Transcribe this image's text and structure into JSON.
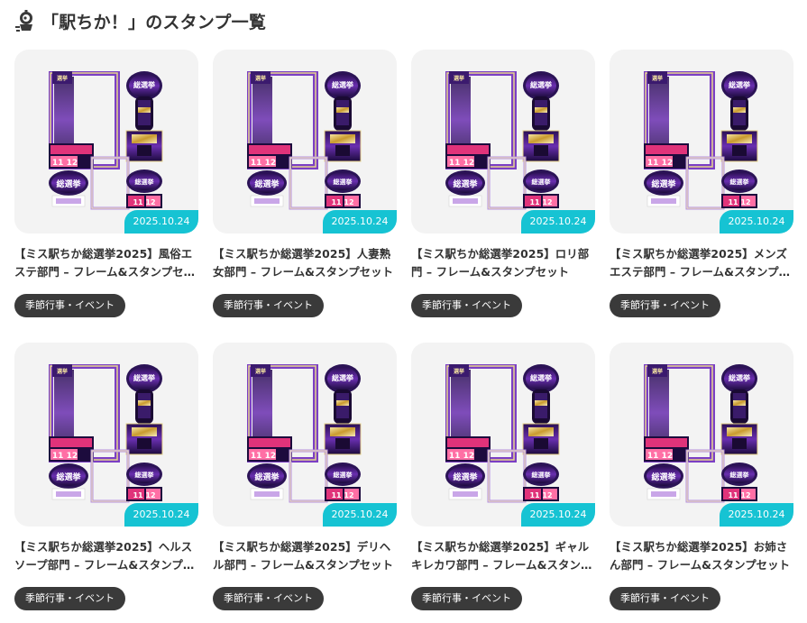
{
  "header": {
    "title": "「駅ちか！」のスタンプ一覧",
    "icon": "mascot-icon"
  },
  "colors": {
    "badge": "#16c3d3",
    "tag_bg": "#3a3a3a",
    "thumb_bg": "#f3f3f3",
    "frame_purple": "#5b2a8e",
    "frame_gold": "#d9b24a",
    "banner_pink": "#e0337a"
  },
  "cards": [
    {
      "title": "【ミス駅ちか総選挙2025】風俗エステ部門 – フレーム&スタンプセ…",
      "date": "2025.10.24",
      "tag": "季節行事・イベント"
    },
    {
      "title": "【ミス駅ちか総選挙2025】人妻熟女部門 – フレーム&スタンプセット",
      "date": "2025.10.24",
      "tag": "季節行事・イベント"
    },
    {
      "title": "【ミス駅ちか総選挙2025】ロリ部門 – フレーム&スタンプセット",
      "date": "2025.10.24",
      "tag": "季節行事・イベント"
    },
    {
      "title": "【ミス駅ちか総選挙2025】メンズエステ部門 – フレーム&スタンプ…",
      "date": "2025.10.24",
      "tag": "季節行事・イベント"
    },
    {
      "title": "【ミス駅ちか総選挙2025】ヘルスソープ部門 – フレーム&スタンプ…",
      "date": "2025.10.24",
      "tag": "季節行事・イベント"
    },
    {
      "title": "【ミス駅ちか総選挙2025】デリヘル部門 – フレーム&スタンプセット",
      "date": "2025.10.24",
      "tag": "季節行事・イベント"
    },
    {
      "title": "【ミス駅ちか総選挙2025】ギャルキレカワ部門 – フレーム&スタン…",
      "date": "2025.10.24",
      "tag": "季節行事・イベント"
    },
    {
      "title": "【ミス駅ちか総選挙2025】お姉さん部門 – フレーム&スタンプセット",
      "date": "2025.10.24",
      "tag": "季節行事・イベント"
    }
  ],
  "art": {
    "logo_text": "総選挙",
    "date_text": "11 12"
  }
}
